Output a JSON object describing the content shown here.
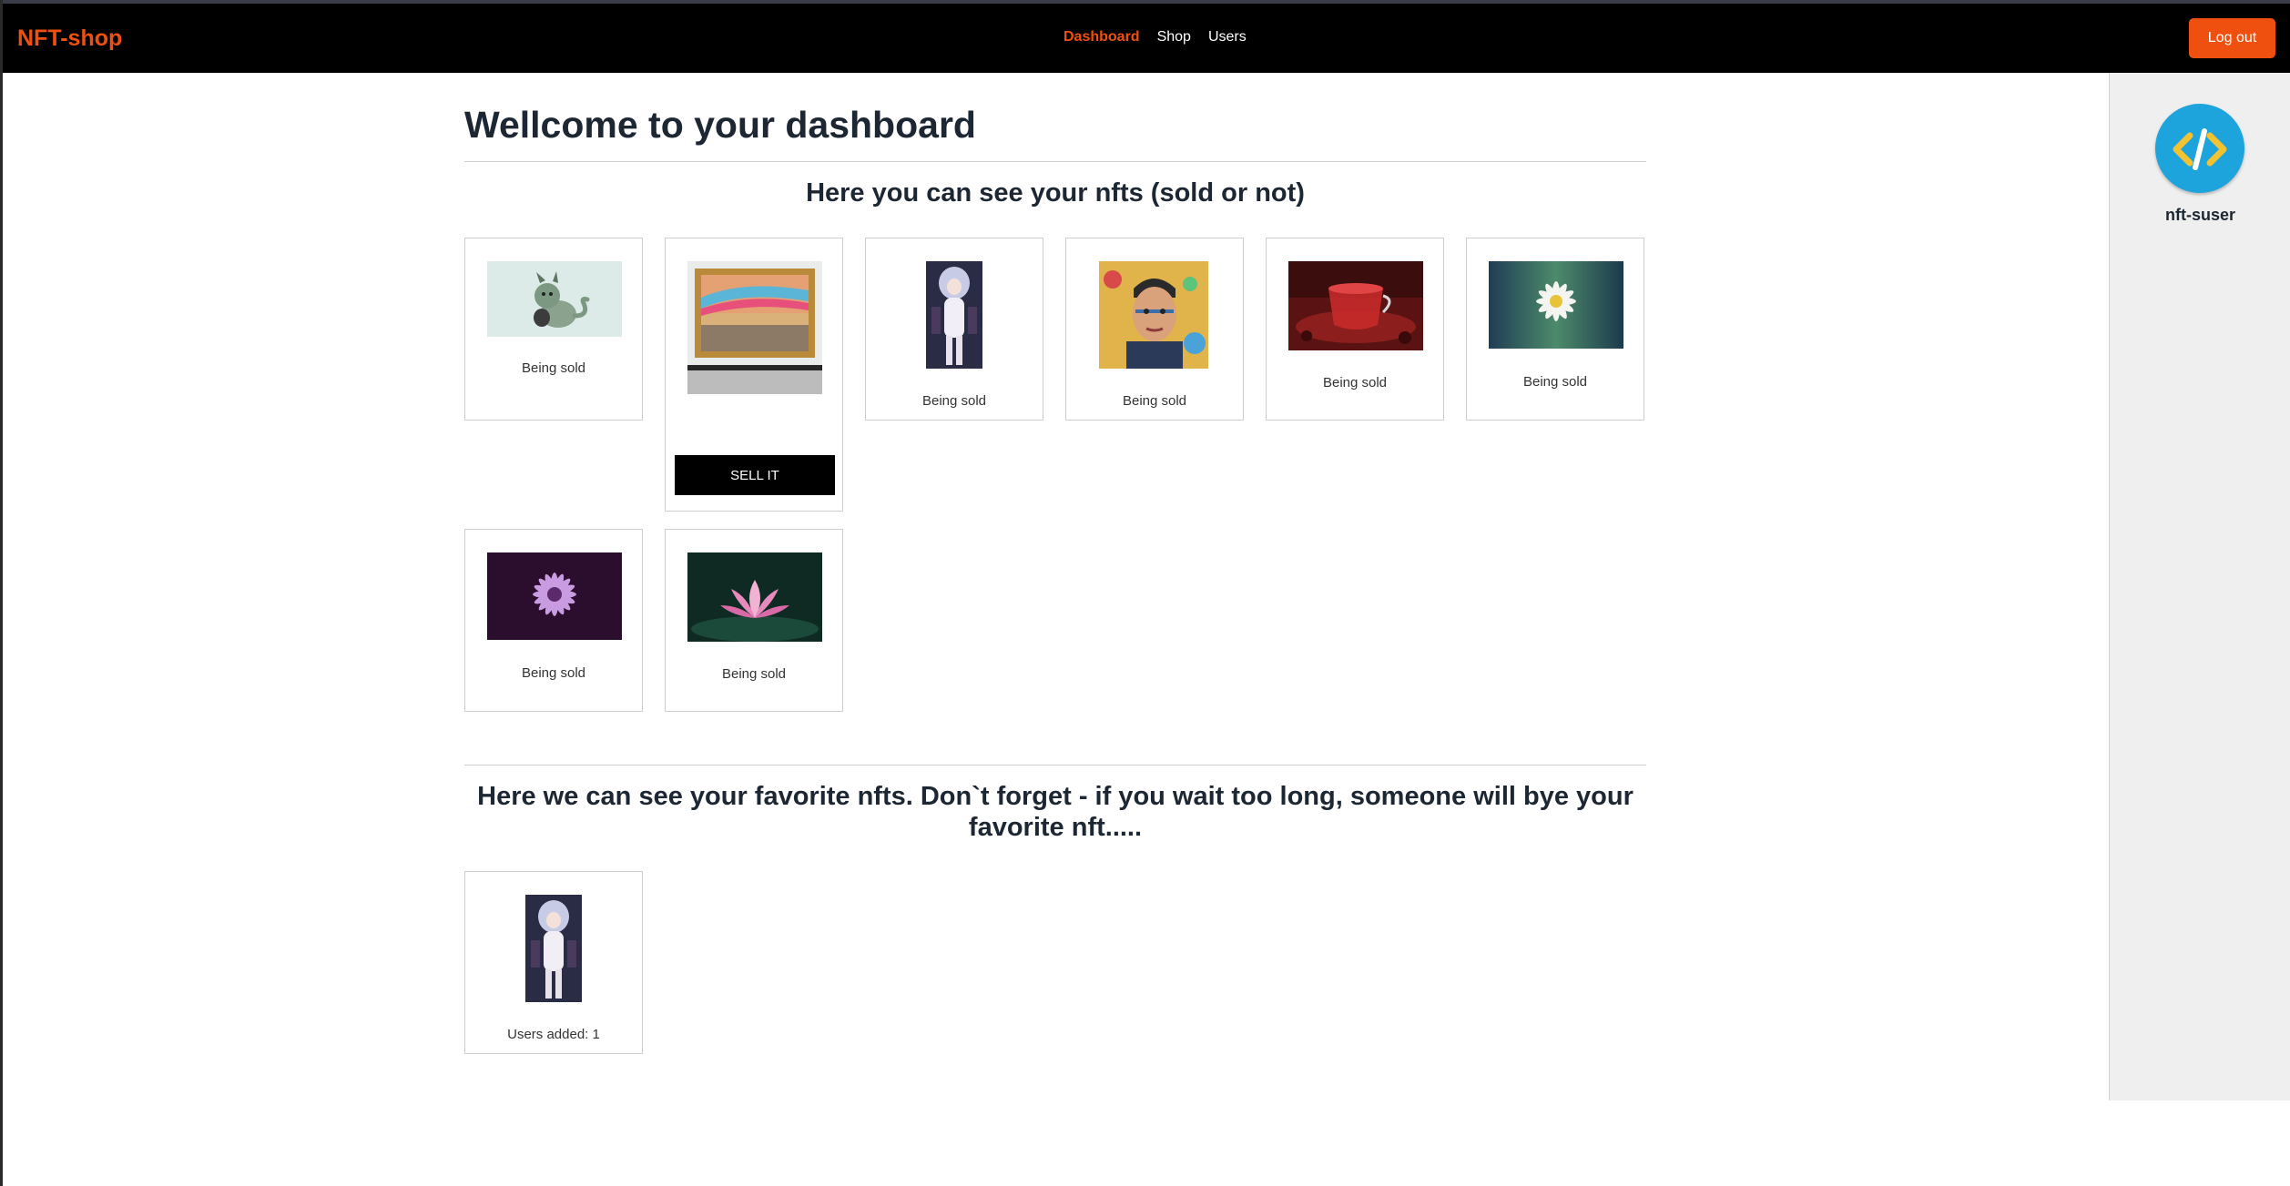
{
  "navbar": {
    "brand": "NFT-shop",
    "links": [
      {
        "label": "Dashboard",
        "active": true
      },
      {
        "label": "Shop",
        "active": false
      },
      {
        "label": "Users",
        "active": false
      }
    ],
    "logout_label": "Log out",
    "accent_color": "#f0500f"
  },
  "sidebar": {
    "username": "nft-suser",
    "avatar_icon": "code-brackets-icon"
  },
  "main": {
    "title": "Wellcome to your dashboard",
    "owned_section_title": "Here you can see your nfts (sold or not)",
    "owned_nfts": [
      {
        "image": "cat-dragon-illustration",
        "status": "Being sold",
        "action": null
      },
      {
        "image": "framed-surreal-painting",
        "status": null,
        "action": "SELL IT"
      },
      {
        "image": "anime-character-portrait",
        "status": "Being sold",
        "action": null
      },
      {
        "image": "pop-art-portrait",
        "status": "Being sold",
        "action": null
      },
      {
        "image": "red-tea-cup",
        "status": "Being sold",
        "action": null
      },
      {
        "image": "white-daisy",
        "status": "Being sold",
        "action": null
      },
      {
        "image": "purple-daisy",
        "status": "Being sold",
        "action": null
      },
      {
        "image": "pink-lotus",
        "status": "Being sold",
        "action": null
      }
    ],
    "favorites_section_title": "Here we can see your favorite nfts. Don`t forget - if you wait too long, someone will bye your favorite nft.....",
    "favorite_nfts": [
      {
        "image": "anime-character-portrait",
        "status": "Users added: 1"
      }
    ]
  }
}
